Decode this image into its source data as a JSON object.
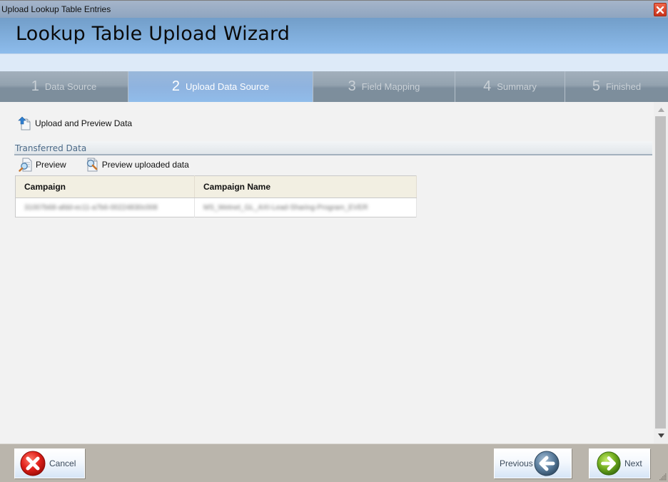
{
  "window": {
    "title": "Upload Lookup Table Entries",
    "close_icon": "close-icon"
  },
  "header": {
    "title": "Lookup Table Upload Wizard"
  },
  "steps": [
    {
      "num": "1",
      "label": "Data Source",
      "active": false
    },
    {
      "num": "2",
      "label": "Upload Data Source",
      "active": true
    },
    {
      "num": "3",
      "label": "Field Mapping",
      "active": false
    },
    {
      "num": "4",
      "label": "Summary",
      "active": false
    },
    {
      "num": "5",
      "label": "Finished",
      "active": false
    }
  ],
  "content": {
    "upload_action": {
      "label": "Upload and Preview Data",
      "icon": "upload-document-icon"
    },
    "section_title": "Transferred Data",
    "toolbar": [
      {
        "label": "Preview",
        "icon": "preview-icon"
      },
      {
        "label": "Preview uploaded data",
        "icon": "preview-uploaded-icon"
      }
    ],
    "table": {
      "columns": [
        "Campaign",
        "Campaign Name"
      ],
      "rows": [
        [
          "31007b68-afdd-ec11-a7b6-00224830c008",
          "MS_Wetnet_GL_AXI-Lead-Sharing-Program_EVER"
        ]
      ],
      "redacted": true
    }
  },
  "footer": {
    "cancel_label": "Cancel",
    "previous_label": "Previous",
    "next_label": "Next"
  },
  "colors": {
    "header_gradient_top": "#729ec9",
    "header_gradient_bottom": "#8dbcec",
    "active_step": "#8fb3df",
    "inactive_step": "#8a9aa8",
    "footer": "#bab5ac",
    "table_header": "#f2efe2"
  }
}
